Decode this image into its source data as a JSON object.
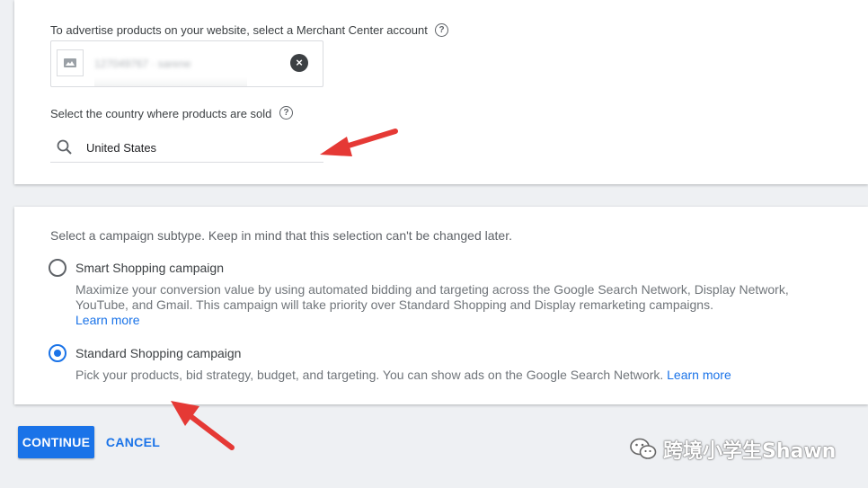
{
  "merchant": {
    "label": "To advertise products on your website, select a Merchant Center account",
    "account_name": "127049767 · sarene"
  },
  "country": {
    "label": "Select the country where products are sold",
    "value": "United States"
  },
  "subtype": {
    "description": "Select a campaign subtype. Keep in mind that this selection can't be changed later.",
    "options": [
      {
        "title": "Smart Shopping campaign",
        "description": "Maximize your conversion value by using automated bidding and targeting across the Google Search Network, Display Network, YouTube, and Gmail. This campaign will take priority over Standard Shopping and Display remarketing campaigns.",
        "link": "Learn more",
        "selected": false
      },
      {
        "title": "Standard Shopping campaign",
        "description": "Pick your products, bid strategy, budget, and targeting. You can show ads on the Google Search Network.",
        "link": "Learn more",
        "selected": true
      }
    ]
  },
  "actions": {
    "continue_label": "CONTINUE",
    "cancel_label": "CANCEL"
  },
  "watermark": {
    "text": "跨境小学生Shawn"
  },
  "colors": {
    "accent": "#1a73e8",
    "annotation_arrow": "#e53935"
  }
}
